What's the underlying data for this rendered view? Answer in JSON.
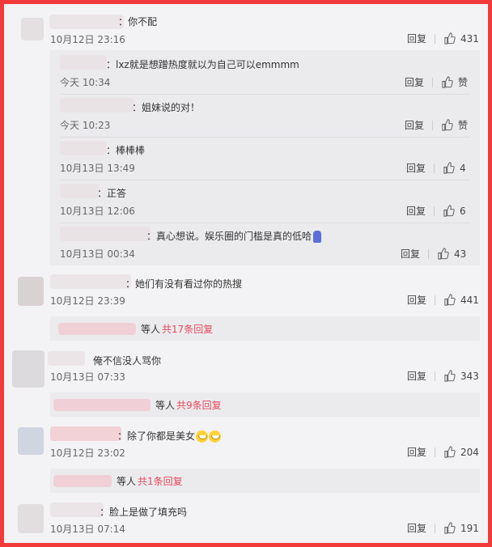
{
  "comments": [
    {
      "text": "：你不配",
      "time": "10月12日 23:16",
      "reply": "回复",
      "likes": "431"
    },
    {
      "text": "：她们有没有看过你的热搜",
      "time": "10月12日 23:39",
      "reply": "回复",
      "likes": "441"
    },
    {
      "text": "俺不信没人骂你",
      "time": "10月13日 07:33",
      "reply": "回复",
      "likes": "343"
    },
    {
      "text": "：除了你都是美女",
      "time": "10月12日 23:02",
      "reply": "回复",
      "likes": "204"
    },
    {
      "text": "：脸上是做了填充吗",
      "time": "10月13日 07:14",
      "reply": "回复",
      "likes": "191"
    }
  ],
  "replies": [
    {
      "text": "：lxz就是想蹭热度就以为自己可以emmmm",
      "time": "今天 10:34",
      "reply": "回复",
      "likes": "赞"
    },
    {
      "text": "：姐妹说的对！",
      "time": "今天 10:23",
      "reply": "回复",
      "likes": "赞"
    },
    {
      "text": "：棒棒棒",
      "time": "10月13日 13:49",
      "reply": "回复",
      "likes": "4"
    },
    {
      "text": "：正答",
      "time": "10月13日 12:06",
      "reply": "回复",
      "likes": "6"
    },
    {
      "text": "：真心想说。娱乐圈的门槛是真的低哈",
      "time": "10月13日 00:34",
      "reply": "回复",
      "likes": "43"
    }
  ],
  "more": [
    {
      "prefix": "等人",
      "link": "共17条回复"
    },
    {
      "prefix": "等人",
      "link": "共9条回复"
    },
    {
      "prefix": "等人",
      "link": "共1条回复"
    }
  ],
  "icons": {
    "like": "thumbs-up-icon",
    "emoji": "grin-emoji-icon",
    "wait": "hourglass-emoji-icon"
  },
  "colors": {
    "border": "#f33a3a",
    "link": "#e8485c",
    "background": "#f3f3f5",
    "reply_box": "#ebebee"
  }
}
